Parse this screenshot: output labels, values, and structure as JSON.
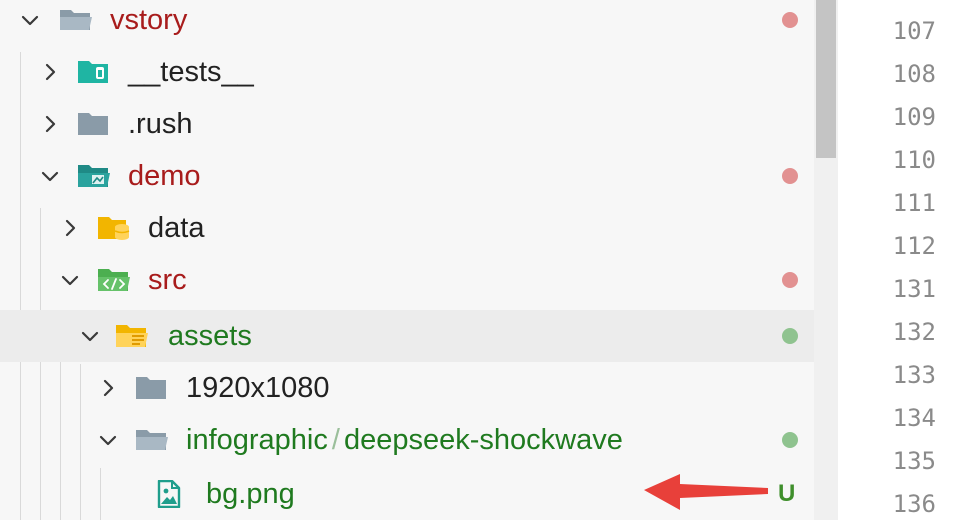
{
  "tree": {
    "items": [
      {
        "label": "vstory",
        "status": "modified"
      },
      {
        "label": "__tests__",
        "status": "none"
      },
      {
        "label": ".rush",
        "status": "none"
      },
      {
        "label": "demo",
        "status": "modified"
      },
      {
        "label": "data",
        "status": "none"
      },
      {
        "label": "src",
        "status": "modified"
      },
      {
        "label": "assets",
        "status": "untracked"
      },
      {
        "label": "1920x1080",
        "status": "none"
      },
      {
        "label": "infographic",
        "label_suffix": "deepseek-shockwave",
        "separator": "/",
        "status": "untracked"
      },
      {
        "label": "bg.png",
        "status": "untracked",
        "badge": "U"
      }
    ]
  },
  "gutter": {
    "line_numbers": [
      "107",
      "108",
      "109",
      "110",
      "111",
      "112",
      "131",
      "132",
      "133",
      "134",
      "135",
      "136"
    ]
  },
  "colors": {
    "modified_dot": "#e29191",
    "untracked_dot": "#8fc38f",
    "modified_text": "#a81c1c",
    "untracked_text": "#1f7a1f",
    "arrow": "#e8403a"
  }
}
